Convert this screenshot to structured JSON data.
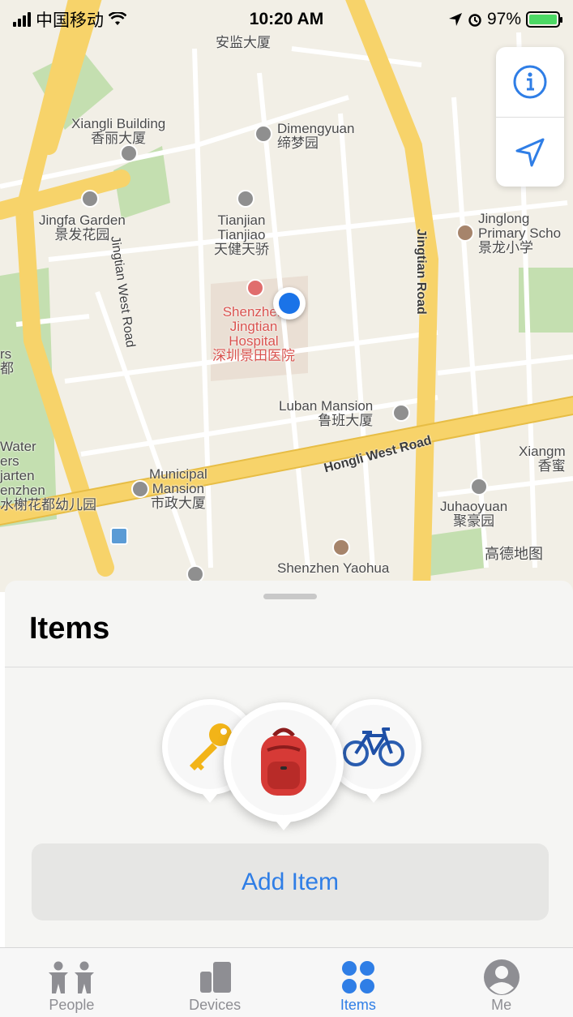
{
  "status_bar": {
    "carrier": "中国移动",
    "time": "10:20 AM",
    "battery": "97%"
  },
  "map": {
    "labels": {
      "anjian": "安监大厦",
      "xiangli": "Xiangli Building\n香丽大厦",
      "dimengyuan": "Dimengyuan\n缔梦园",
      "jingfa": "Jingfa Garden\n景发花园",
      "tianjian": "Tianjian\nTianjiao\n天健天骄",
      "jinglong": "Jinglong\nPrimary Scho\n景龙小学",
      "hospital": "Shenzhen\nJingtian\nHospital\n深圳景田医院",
      "luban": "Luban Mansion\n鲁班大厦",
      "municipal": "Municipal\nMansion\n市政大厦",
      "juhaoyuan": "Juhaoyuan\n聚豪园",
      "water": "Water\ners\njarten\nenzhen\n水榭花都幼儿园",
      "rs": "rs\n都",
      "xiangm": "Xiangm\n香蜜",
      "yaohua": "Shenzhen Yaohua",
      "gaode": "高德地图",
      "jingtian_west": "Jingtian West Road",
      "jingtian_road": "Jingtian Road",
      "hongli": "Hongli West Road"
    }
  },
  "sheet": {
    "title": "Items",
    "add_button": "Add Item"
  },
  "tabs": [
    {
      "label": "People"
    },
    {
      "label": "Devices"
    },
    {
      "label": "Items"
    },
    {
      "label": "Me"
    }
  ],
  "colors": {
    "accent": "#2f7ee6",
    "inactive": "#8e8e93"
  }
}
